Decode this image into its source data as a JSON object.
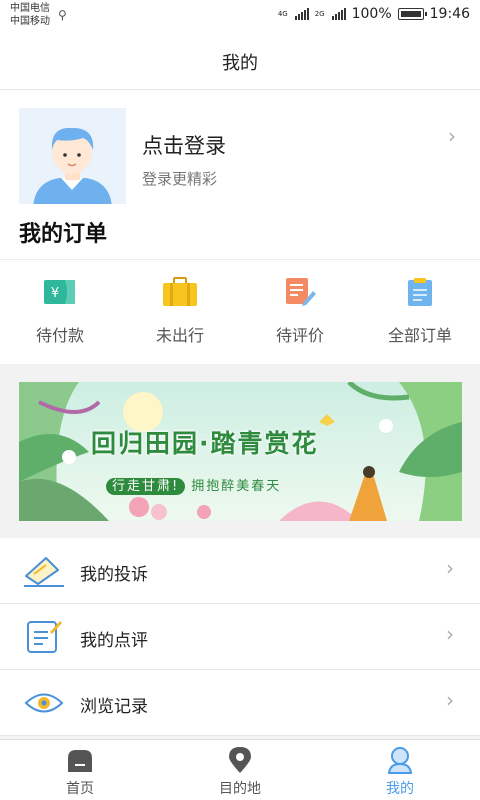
{
  "status_bar": {
    "carrier_1": "中国电信",
    "carrier_2": "中国移动",
    "net_1": "4G",
    "net_2": "2G",
    "battery": "100%",
    "time": "19:46"
  },
  "header": {
    "title": "我的"
  },
  "profile": {
    "login_title": "点击登录",
    "login_sub": "登录更精彩"
  },
  "orders": {
    "title": "我的订单",
    "items": [
      {
        "label": "待付款",
        "icon": "wallet-icon"
      },
      {
        "label": "未出行",
        "icon": "suitcase-icon"
      },
      {
        "label": "待评价",
        "icon": "review-icon"
      },
      {
        "label": "全部订单",
        "icon": "clipboard-icon"
      }
    ]
  },
  "banner": {
    "title": "回归田园·踏青赏花",
    "tag": "行走甘肃!",
    "subtitle": "拥抱醉美春天"
  },
  "menu": {
    "items": [
      {
        "label": "我的投诉",
        "icon": "complaint-icon"
      },
      {
        "label": "我的点评",
        "icon": "comment-icon"
      },
      {
        "label": "浏览记录",
        "icon": "eye-icon"
      }
    ]
  },
  "tabbar": {
    "items": [
      {
        "label": "首页",
        "icon": "home-icon",
        "active": false
      },
      {
        "label": "目的地",
        "icon": "location-icon",
        "active": false
      },
      {
        "label": "我的",
        "icon": "profile-icon",
        "active": true
      }
    ]
  },
  "colors": {
    "accent": "#4a9be8",
    "banner_green": "#2e8b3e"
  }
}
